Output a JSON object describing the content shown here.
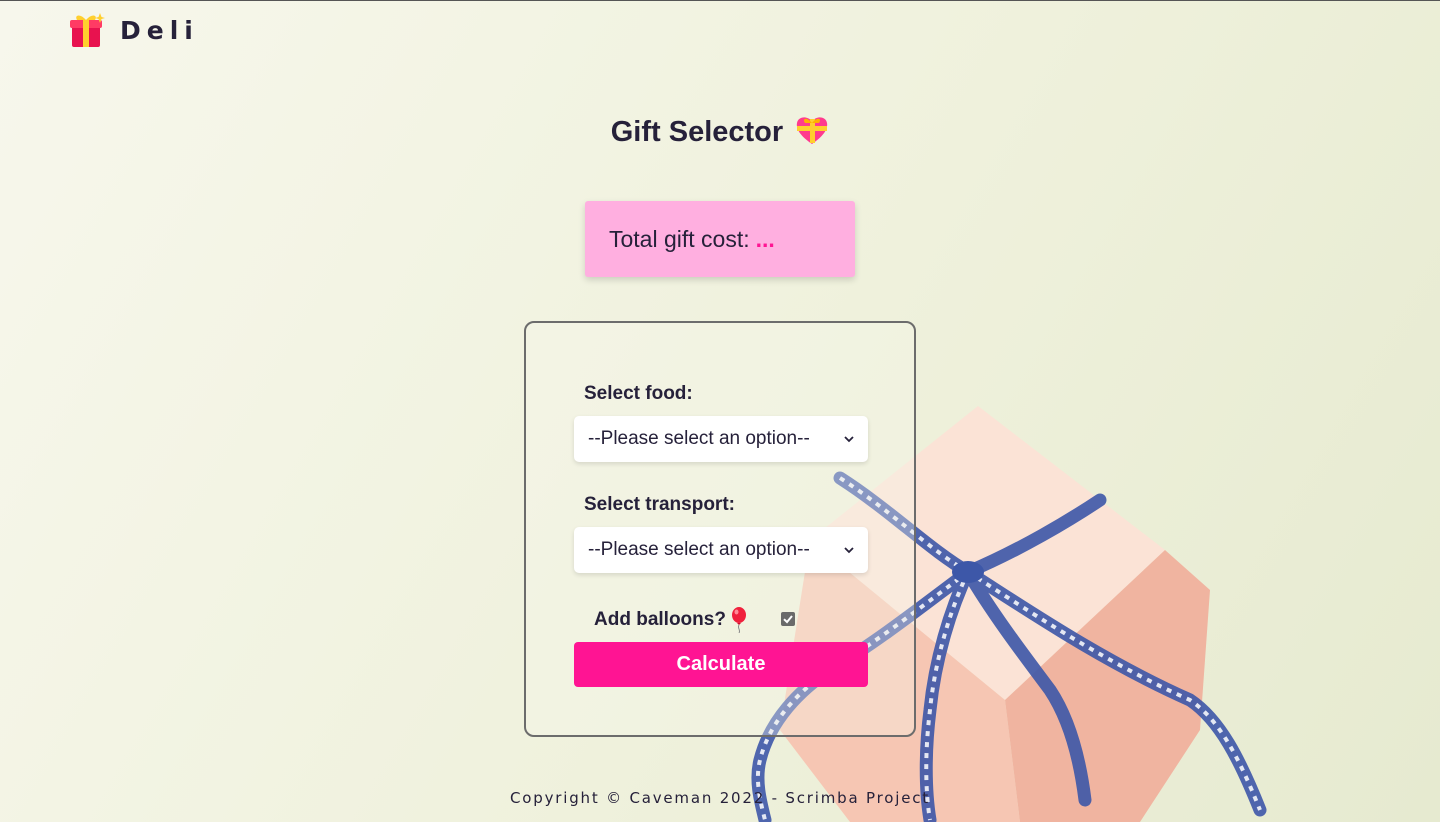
{
  "navbar": {
    "brand": "Deli",
    "logo_icon": "gift-icon"
  },
  "page": {
    "title": "Gift Selector",
    "title_icon": "heart-with-ribbon-icon"
  },
  "total": {
    "label": "Total gift cost:",
    "value": "..."
  },
  "form": {
    "food_label": "Select food:",
    "food_selected": "--Please select an option--",
    "transport_label": "Select transport:",
    "transport_selected": "--Please select an option--",
    "balloons_label": "Add balloons?",
    "balloons_icon": "balloon-icon",
    "balloons_checked": true,
    "calculate_label": "Calculate"
  },
  "footer": {
    "text": "Copyright © Caveman 2022 - Scrimba Project"
  },
  "colors": {
    "accent": "#ff1493",
    "total_box": "#ffafe0",
    "text": "#26213a"
  }
}
